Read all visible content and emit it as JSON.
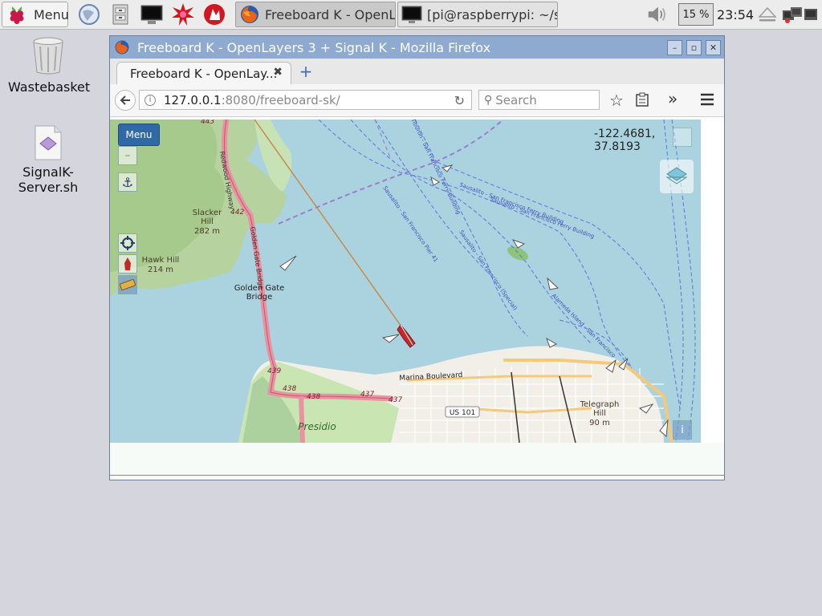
{
  "taskbar": {
    "menu_label": "Menu",
    "tasks": [
      {
        "label": "Freeboard K - OpenLa..."
      },
      {
        "label": "[pi@raspberrypi: ~/si..."
      }
    ],
    "cpu": "15 %",
    "clock": "23:54"
  },
  "desktop": {
    "wastebasket": "Wastebasket",
    "script_line1": "SignalK-",
    "script_line2": "Server.sh"
  },
  "window": {
    "title": "Freeboard K - OpenLayers 3 + Signal K - Mozilla Firefox",
    "tab_title": "Freeboard K - OpenLay...",
    "url_host": "127.0.0.1",
    "url_rest": ":8080/freeboard-sk/",
    "search_placeholder": "Search"
  },
  "map": {
    "menu_label": "Menu",
    "coords": "-122.4681, 37.8193",
    "labels": {
      "slacker": "Slacker",
      "hill": "Hill",
      "slacker_elev": "282 m",
      "hawk": "Hawk Hill",
      "hawk_elev": "214 m",
      "gg1": "Golden Gate",
      "gg2": "Bridge",
      "telegraph": "Telegraph",
      "telegraph_hill": "Hill",
      "telegraph_elev": "90 m",
      "presidio": "Presidio",
      "marina": "Marina Boulevard",
      "us101": "US 101",
      "r443": "443",
      "r442": "442",
      "r439": "439",
      "r438a": "438",
      "r438b": "438",
      "r437a": "437",
      "r437b": "437",
      "ggb_road": "Golden Gate Bridge",
      "hwy": "Redwood Highway",
      "ferry1": "Sausalito - San Francisco Ferry Building",
      "ferry2": "Tiburon - San Francisco Ferry Building",
      "ferry3": "Sausalito - San Francisco Ferry Building",
      "ferry4": "Sausalito - San Francisco Pier 41",
      "ferry5": "Alameda Island - San Francisco",
      "ferry6": "Sausalito - San Francisco (Special)"
    }
  }
}
